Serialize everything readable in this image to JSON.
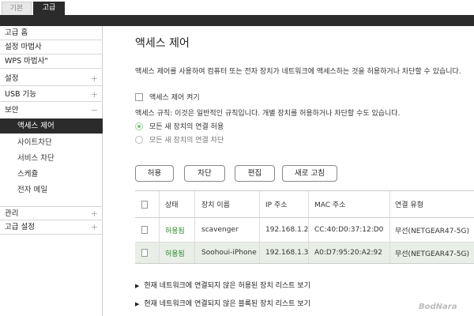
{
  "tabs": {
    "basic": "기본",
    "advanced": "고급"
  },
  "sidebar": {
    "items": [
      {
        "label": "고급 홈",
        "toggle": ""
      },
      {
        "label": "설정 마법사",
        "toggle": ""
      },
      {
        "label": "WPS 마법사\"",
        "toggle": ""
      },
      {
        "label": "설정",
        "toggle": "+"
      },
      {
        "label": "USB 기능",
        "toggle": "+"
      },
      {
        "label": "보안",
        "toggle": "−"
      }
    ],
    "security_sub": [
      "액세스 제어",
      "사이트차단",
      "서비스 차단",
      "스케쥴",
      "전자 메일"
    ],
    "bottom": [
      {
        "label": "관리",
        "toggle": "+"
      },
      {
        "label": "고급 설정",
        "toggle": "+"
      }
    ]
  },
  "main": {
    "title": "액세스 제어",
    "description": "액세스 제어를 사용하여 컴퓨터 또는 전자 장치가 네트워크에 액세스하는 것을 허용하거나 차단할 수 있습니다.",
    "enable_label": "액세스 제어 켜기",
    "rule_text": "액세스 규칙: 이것은 일반적인 규칙입니다. 개별 장치를 허용하거나 차단할 수도 있습니다.",
    "radio_allow": "모든 새 장치의 연결 허용",
    "radio_block": "모든 새 장치의 연결 차단",
    "buttons": {
      "allow": "허용",
      "block": "차단",
      "edit": "편집",
      "refresh": "새로 고침"
    },
    "table": {
      "headers": [
        "상태",
        "장치 이름",
        "IP 주소",
        "MAC 주소",
        "연결 유형"
      ],
      "rows": [
        [
          "허용됨",
          "scavenger",
          "192.168.1.2",
          "CC:40:D0:37:12:D0",
          "무선(NETGEAR47-5G)"
        ],
        [
          "허용됨",
          "Soohoui-iPhone",
          "192.168.1.3",
          "A0:D7:95:20:A2:92",
          "무선(NETGEAR47-5G)"
        ]
      ]
    },
    "link_allowed": "현재 네트워크에 연결되지 않은 허용된 장치 리스트 보기",
    "link_blocked": "현재 네트워크에 연결되지 않은 블록된 장치 리스트 보기"
  },
  "watermark": "BodNara",
  "colors": {
    "dark_bar": "#2b2b2b",
    "allowed_text": "#2f8a2f",
    "selected_row": "#e9eee6"
  }
}
